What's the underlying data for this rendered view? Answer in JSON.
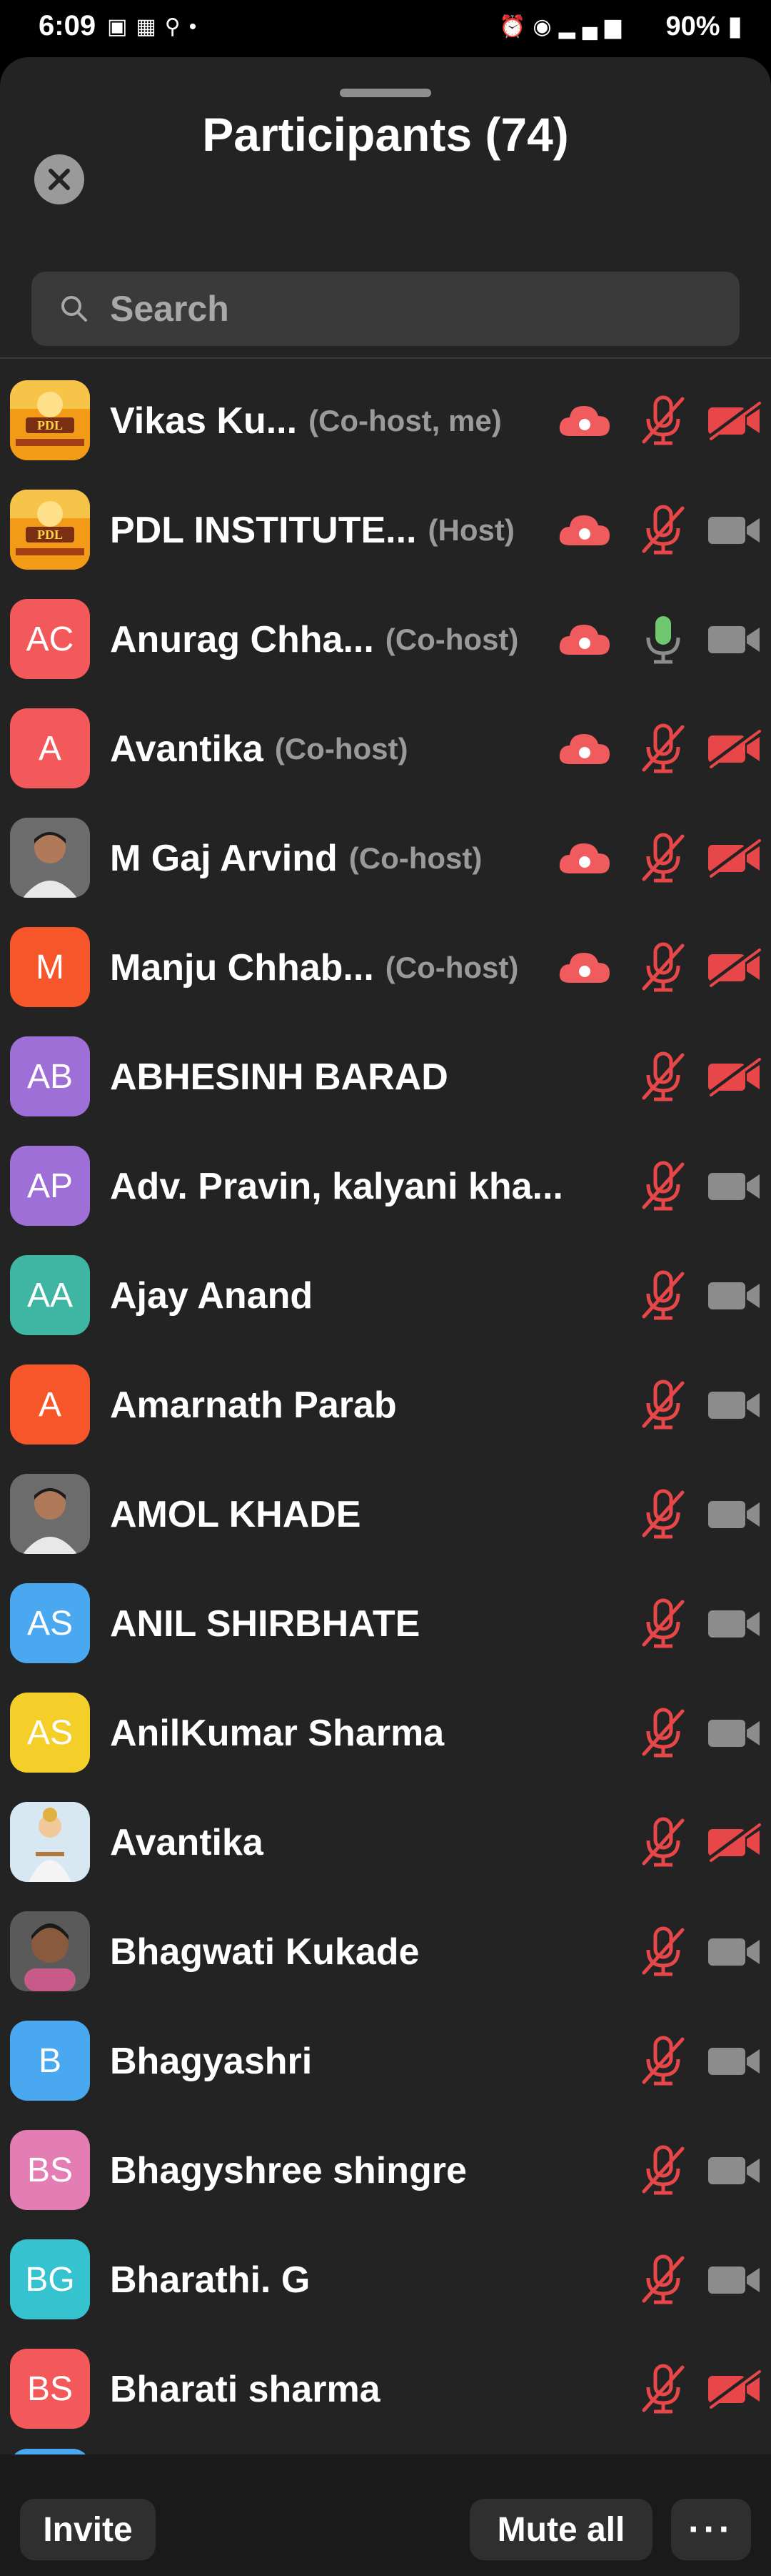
{
  "status_bar": {
    "time": "6:09",
    "battery": "90%",
    "icons": [
      "gallery-icon",
      "calendar-icon",
      "location-icon",
      "dot-icon",
      "alarm-icon",
      "hotspot-icon",
      "volte-icon",
      "4g-icon",
      "signal-icon",
      "battery-icon"
    ]
  },
  "header": {
    "title": "Participants (74)"
  },
  "search": {
    "placeholder": "Search"
  },
  "colors": {
    "sheet": "#232323",
    "muted_red": "#e8474a",
    "mic_on": "#6fc86f",
    "cam_off_gray": "#8c8c8c"
  },
  "participants": [
    {
      "name": "Vikas Ku...",
      "role": "(Co-host, me)",
      "avatar_type": "photo",
      "avatar_photo": "pdl-logo",
      "recording": true,
      "mic": "muted",
      "video": "off"
    },
    {
      "name": "PDL INSTITUTE...",
      "role": "(Host)",
      "avatar_type": "photo",
      "avatar_photo": "pdl-logo",
      "recording": true,
      "mic": "muted",
      "video": "on"
    },
    {
      "name": "Anurag Chha...",
      "role": "(Co-host)",
      "avatar_type": "initials",
      "initials": "AC",
      "avatar_color": "#f3585a",
      "recording": true,
      "mic": "on",
      "video": "on"
    },
    {
      "name": "Avantika",
      "role": "(Co-host)",
      "avatar_type": "initials",
      "initials": "A",
      "avatar_color": "#f3585a",
      "recording": true,
      "mic": "muted",
      "video": "off"
    },
    {
      "name": "M Gaj Arvind",
      "role": "(Co-host)",
      "avatar_type": "photo",
      "avatar_photo": "man-photo",
      "recording": true,
      "mic": "muted",
      "video": "off"
    },
    {
      "name": "Manju Chhab...",
      "role": "(Co-host)",
      "avatar_type": "initials",
      "initials": "M",
      "avatar_color": "#f7552a",
      "recording": true,
      "mic": "muted",
      "video": "off"
    },
    {
      "name": "ABHESINH BARAD",
      "role": "",
      "avatar_type": "initials",
      "initials": "AB",
      "avatar_color": "#9f6fd8",
      "recording": false,
      "mic": "muted",
      "video": "off"
    },
    {
      "name": "Adv. Pravin, kalyani kha...",
      "role": "",
      "avatar_type": "initials",
      "initials": "AP",
      "avatar_color": "#9f6fd8",
      "recording": false,
      "mic": "muted",
      "video": "on"
    },
    {
      "name": "Ajay Anand",
      "role": "",
      "avatar_type": "initials",
      "initials": "AA",
      "avatar_color": "#3fb5a3",
      "recording": false,
      "mic": "muted",
      "video": "on"
    },
    {
      "name": "Amarnath Parab",
      "role": "",
      "avatar_type": "initials",
      "initials": "A",
      "avatar_color": "#f7552a",
      "recording": false,
      "mic": "muted",
      "video": "on"
    },
    {
      "name": "AMOL KHADE",
      "role": "",
      "avatar_type": "photo",
      "avatar_photo": "man-photo",
      "recording": false,
      "mic": "muted",
      "video": "on"
    },
    {
      "name": "ANIL SHIRBHATE",
      "role": "",
      "avatar_type": "initials",
      "initials": "AS",
      "avatar_color": "#4aa8f0",
      "recording": false,
      "mic": "muted",
      "video": "on"
    },
    {
      "name": "AnilKumar Sharma",
      "role": "",
      "avatar_type": "initials",
      "initials": "AS",
      "avatar_color": "#f4cf2a",
      "recording": false,
      "mic": "muted",
      "video": "on"
    },
    {
      "name": "Avantika",
      "role": "",
      "avatar_type": "photo",
      "avatar_photo": "deity-photo",
      "recording": false,
      "mic": "muted",
      "video": "off"
    },
    {
      "name": "Bhagwati Kukade",
      "role": "",
      "avatar_type": "photo",
      "avatar_photo": "woman-photo",
      "recording": false,
      "mic": "muted",
      "video": "on"
    },
    {
      "name": "Bhagyashri",
      "role": "",
      "avatar_type": "initials",
      "initials": "B",
      "avatar_color": "#4aa8f0",
      "recording": false,
      "mic": "muted",
      "video": "on"
    },
    {
      "name": "Bhagyshree shingre",
      "role": "",
      "avatar_type": "initials",
      "initials": "BS",
      "avatar_color": "#e47db4",
      "recording": false,
      "mic": "muted",
      "video": "on"
    },
    {
      "name": "Bharathi. G",
      "role": "",
      "avatar_type": "initials",
      "initials": "BG",
      "avatar_color": "#36c3d0",
      "recording": false,
      "mic": "muted",
      "video": "on"
    },
    {
      "name": "Bharati sharma",
      "role": "",
      "avatar_type": "initials",
      "initials": "BS",
      "avatar_color": "#f3585a",
      "recording": false,
      "mic": "muted",
      "video": "off"
    }
  ],
  "footer": {
    "invite_label": "Invite",
    "mute_all_label": "Mute all",
    "more_label": "···"
  }
}
